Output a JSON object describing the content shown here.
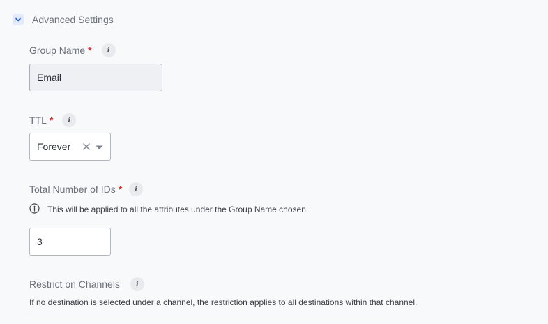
{
  "section": {
    "title": "Advanced Settings"
  },
  "group_name": {
    "label": "Group Name",
    "required_mark": "*",
    "info_glyph": "i",
    "value": "Email"
  },
  "ttl": {
    "label": "TTL",
    "required_mark": "*",
    "info_glyph": "i",
    "selected": "Forever"
  },
  "total_ids": {
    "label": "Total Number of IDs",
    "required_mark": "*",
    "info_glyph": "i",
    "hint": "This will be applied to all the attributes under the Group Name chosen.",
    "value": "3"
  },
  "restrict_channels": {
    "label": "Restrict on Channels",
    "info_glyph": "i",
    "description": "If no destination is selected under a channel, the restriction applies to all destinations within that channel."
  },
  "colors": {
    "required": "#d32f2f",
    "accent": "#1f5fbf"
  }
}
